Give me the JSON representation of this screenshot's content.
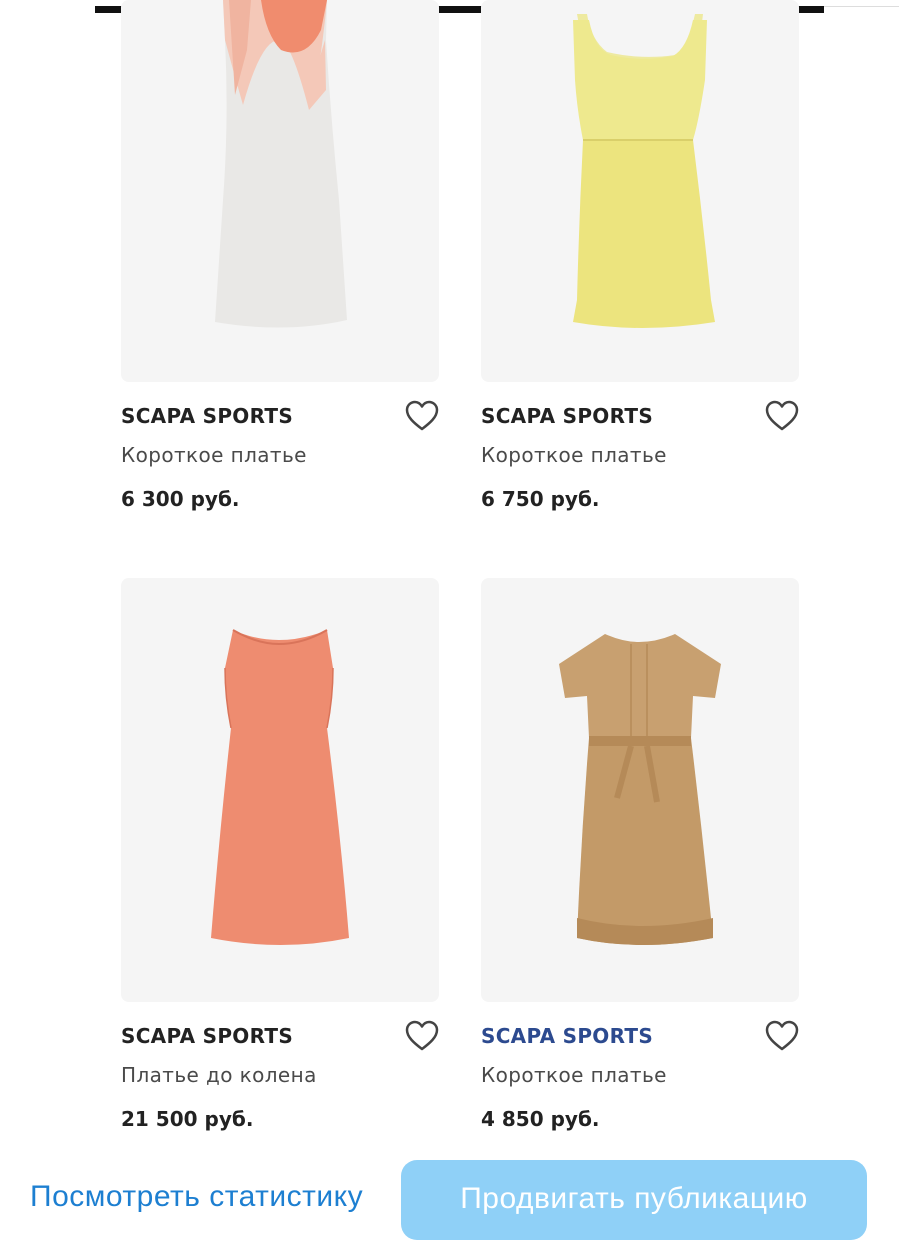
{
  "products": [
    {
      "brand": "SCAPA SPORTS",
      "name": "Короткое платье",
      "price": "6 300 руб.",
      "image_icon": "dress-white-coral-image",
      "favorite_icon": "heart-outline-icon"
    },
    {
      "brand": "SCAPA SPORTS",
      "name": "Короткое платье",
      "price": "6 750 руб.",
      "image_icon": "dress-yellow-image",
      "favorite_icon": "heart-outline-icon"
    },
    {
      "brand": "SCAPA SPORTS",
      "name": "Платье до колена",
      "price": "21 500 руб.",
      "image_icon": "dress-coral-image",
      "favorite_icon": "heart-outline-icon"
    },
    {
      "brand": "SCAPA SPORTS",
      "name": "Короткое платье",
      "price": "4 850 руб.",
      "image_icon": "dress-beige-image",
      "favorite_icon": "heart-outline-icon"
    }
  ],
  "footer": {
    "statistics_link": "Посмотреть статистику",
    "promote_button": "Продвигать публикацию"
  },
  "colors": {
    "image_background": "#f5f5f5",
    "brand_text": "#222222",
    "brand_text_highlight": "#2c4a8f",
    "link": "#1d7fd1",
    "button_background": "#8fd0f7"
  }
}
